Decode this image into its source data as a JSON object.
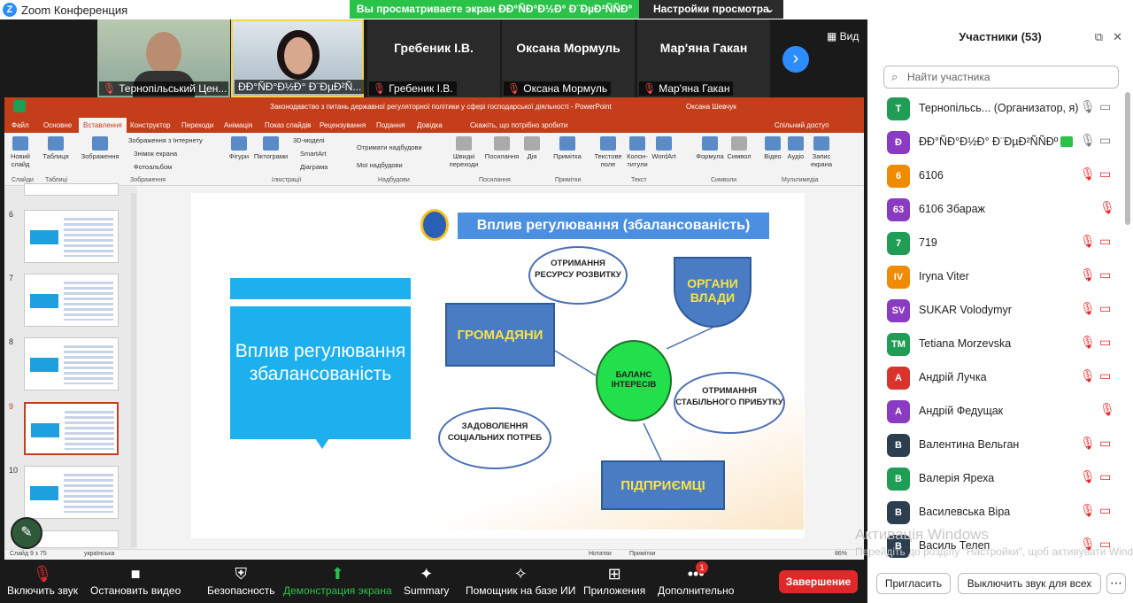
{
  "app": {
    "title": "Zoom Конференция"
  },
  "share_banner": "Вы просматриваете экран ÐÐ°ÑÐ°Ð½Ð° Ð¨ÐµÐ²ÑÑÐº",
  "view_options": "Настройки просмотра",
  "view_button": "Вид",
  "video_tiles": [
    {
      "label": "Тернопільський Цен..."
    },
    {
      "label": "ÐÐ°ÑÐ°Ð½Ð° Ð¨ÐµÐ²Ñ..."
    },
    {
      "name": "Гребеник І.В.",
      "label": "Гребеник І.В."
    },
    {
      "name": "Оксана Мормуль",
      "label": "Оксана Мормуль"
    },
    {
      "name": "Мар'яна Гакан",
      "label": "Мар'яна Гакан"
    }
  ],
  "ppt": {
    "doc_title": "Законодавство з питань державної регуляторної політики у сфері господарської діяльності  -  PowerPoint",
    "user": "Оксана Шевчук",
    "tabs": [
      "Файл",
      "Основне",
      "Вставлення",
      "Конструктор",
      "Переходи",
      "Анімація",
      "Показ слайдів",
      "Рецензування",
      "Подання",
      "Довідка",
      "Скажіть, що потрібно зробити",
      "Спільний доступ"
    ],
    "ribbon": {
      "new_slide": "Новий слайд",
      "table": "Таблиця",
      "pictures": "Зображення",
      "online_pictures": "Зображення з Інтернету",
      "screenshot": "Знімок екрана",
      "photo_album": "Фотоальбом",
      "shapes": "Фігури",
      "icons": "Піктограми",
      "models3d": "3D-моделі",
      "smartart": "SmartArt",
      "chart": "Діаграма",
      "get_addins": "Отримати надбудови",
      "my_addins": "Мої надбудови",
      "zoom": "Швидкі переходи",
      "link": "Посилання",
      "action": "Дія",
      "comment": "Примітка",
      "textbox": "Текстове поле",
      "header": "Колон-титули",
      "wordart": "WordArt",
      "equation": "Формула",
      "symbol": "Символ",
      "video": "Відео",
      "audio": "Аудіо",
      "screen_rec": "Запис екрана",
      "groups": [
        "Слайди",
        "Таблиці",
        "Зображення",
        "Ілюстрації",
        "Надбудови",
        "Посилання",
        "Примітки",
        "Текст",
        "Символи",
        "Мультимедіа"
      ]
    },
    "thumb_numbers": [
      "6",
      "7",
      "8",
      "9",
      "10"
    ],
    "slide": {
      "left_title": "Вплив регулювання збалансованість",
      "banner": "Вплив регулювання (збалансованість)",
      "clouds": [
        "ОТРИМАННЯ РЕСУРСУ РОЗВИТКУ",
        "ЗАДОВОЛЕННЯ СОЦІАЛЬНИХ ПОТРЕБ",
        "ОТРИМАННЯ СТАБІЛЬНОГО ПРИБУТКУ"
      ],
      "boxes": [
        "ГРОМАДЯНИ",
        "ОРГАНИ ВЛАДИ",
        "ПІДПРИЄМЦІ"
      ],
      "center": "БАЛАНС ІНТЕРЕСІВ"
    },
    "status": {
      "slide": "Слайд 9 з 75",
      "lang": "українська",
      "notes": "Нотатки",
      "comments": "Примітки",
      "zoom": "86%"
    }
  },
  "toolbar": {
    "mute": "Включить звук",
    "video": "Остановить видео",
    "security": "Безопасность",
    "share": "Демонстрация экрана",
    "summary": "Summary",
    "ai": "Помощник на базе ИИ",
    "apps": "Приложения",
    "more": "Дополнительно",
    "more_badge": "1",
    "end": "Завершение"
  },
  "participants": {
    "title": "Участники (53)",
    "search_placeholder": "Найти участника",
    "list": [
      {
        "initial": "T",
        "name": "Тернопільсь...  (Организатор, я)",
        "color": "#1f9d55"
      },
      {
        "initial": "Ð",
        "name": "ÐÐ°ÑÐ°Ð½Ð° Ð¨ÐµÐ²ÑÑÐº",
        "color": "#8a3bc2"
      },
      {
        "initial": "6",
        "name": "6106",
        "color": "#f08a00"
      },
      {
        "initial": "63",
        "name": "6106 Збараж",
        "color": "#8a3bc2"
      },
      {
        "initial": "7",
        "name": "719",
        "color": "#1f9d55"
      },
      {
        "initial": "IV",
        "name": "Iryna Viter",
        "color": "#f08a00"
      },
      {
        "initial": "SV",
        "name": "SUKAR Volodymyr",
        "color": "#8a3bc2"
      },
      {
        "initial": "TM",
        "name": "Tetiana Morzevska",
        "color": "#1f9d55"
      },
      {
        "initial": "А",
        "name": "Андрій Лучка",
        "color": "#d9342b"
      },
      {
        "initial": "А",
        "name": "Андрій Федущак",
        "color": "#8a3bc2"
      },
      {
        "initial": "В",
        "name": "Валентина Вельган",
        "color": "#2c3e50"
      },
      {
        "initial": "В",
        "name": "Валерія Яреха",
        "color": "#1f9d55"
      },
      {
        "initial": "В",
        "name": "Василевська Віра",
        "color": "#2c3e50"
      },
      {
        "initial": "В",
        "name": "Василь Телеп",
        "color": "#2c3e50"
      }
    ],
    "invite": "Пригласить",
    "mute_all": "Выключить звук для всех"
  },
  "watermark": {
    "line1": "Активація Windows",
    "line2": "Перейдіть до розділу \"Настройки\", щоб активувати Windows."
  }
}
